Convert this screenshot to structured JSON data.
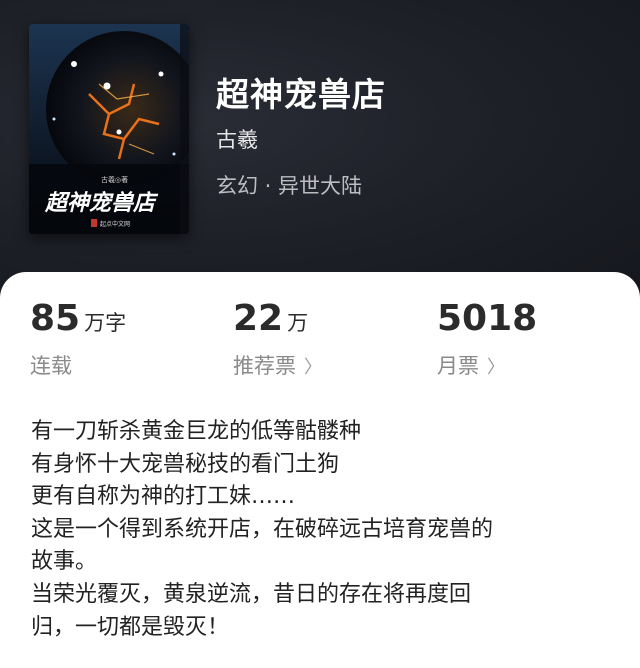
{
  "book": {
    "title": "超神宠兽店",
    "author": "古羲",
    "genre": "玄幻 · 异世大陆",
    "cover": {
      "title_text": "超神宠兽店",
      "author_text": "古羲◎著",
      "publisher_text": "起点中文网"
    }
  },
  "stats": {
    "words": {
      "value": "85",
      "unit": "万字",
      "label": "连载"
    },
    "recommend": {
      "value": "22",
      "unit": "万",
      "label": "推荐票"
    },
    "monthly": {
      "value": "5018",
      "unit": "",
      "label": "月票"
    }
  },
  "description": [
    "有一刀斩杀黄金巨龙的低等骷髅种",
    "有身怀十大宠兽秘技的看门土狗",
    "更有自称为神的打工妹……",
    "这是一个得到系统开店，在破碎远古培育宠兽的",
    "故事。",
    "当荣光覆灭，黄泉逆流，昔日的存在将再度回",
    "归，一切都是毁灭！"
  ],
  "colors": {
    "header_bg": "#1b1d24",
    "card_bg": "#ffffff",
    "primary_text": "#2b2b2b",
    "secondary_text": "#8a8a8a"
  }
}
